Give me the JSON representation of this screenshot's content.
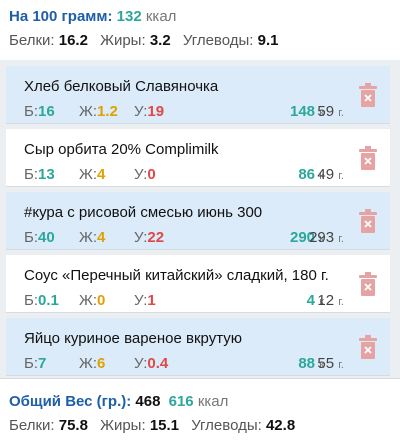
{
  "header": {
    "per100_label": "На 100 грамм:",
    "per100_kcal_value": "132",
    "per100_kcal_unit": "ккал",
    "protein_label": "Белки:",
    "protein_value": "16.2",
    "fat_label": "Жиры:",
    "fat_value": "3.2",
    "carbs_label": "Углеводы:",
    "carbs_value": "9.1"
  },
  "macro_labels": {
    "p": "Б:",
    "f": "Ж:",
    "c": "У:"
  },
  "units": {
    "kcal": "к",
    "grams": "г."
  },
  "items": [
    {
      "name": "Хлеб белковый Славяночка",
      "p": "16",
      "f": "1.2",
      "c": "19",
      "kcal": "148",
      "grams": "59"
    },
    {
      "name": "Сыр орбита 20% Complimilk",
      "p": "13",
      "f": "4",
      "c": "0",
      "kcal": "86",
      "grams": "49"
    },
    {
      "name": "#кура с рисовой смесью июнь 300",
      "p": "40",
      "f": "4",
      "c": "22",
      "kcal": "290",
      "grams": "293"
    },
    {
      "name": "Соус «Перечный китайский» сладкий, 180 г.",
      "p": "0.1",
      "f": "0",
      "c": "1",
      "kcal": "4",
      "grams": "12"
    },
    {
      "name": "Яйцо куриное вареное вкрутую",
      "p": "7",
      "f": "6",
      "c": "0.4",
      "kcal": "88",
      "grams": "55"
    }
  ],
  "footer": {
    "total_weight_label": "Общий Вес (гр.):",
    "total_weight_value": "468",
    "total_kcal_value": "616",
    "total_kcal_unit": "ккал",
    "protein_label": "Белки:",
    "protein_value": "75.8",
    "fat_label": "Жиры:",
    "fat_value": "15.1",
    "carbs_label": "Углеводы:",
    "carbs_value": "42.8"
  },
  "icons": {
    "delete": "trash-icon"
  },
  "colors": {
    "accent_blue": "#1e5fa8",
    "teal": "#2ca79b",
    "fat": "#e0a100",
    "carbs": "#e04848",
    "row_highlight": "#dcebf9",
    "trash": "#e6a3a3"
  }
}
